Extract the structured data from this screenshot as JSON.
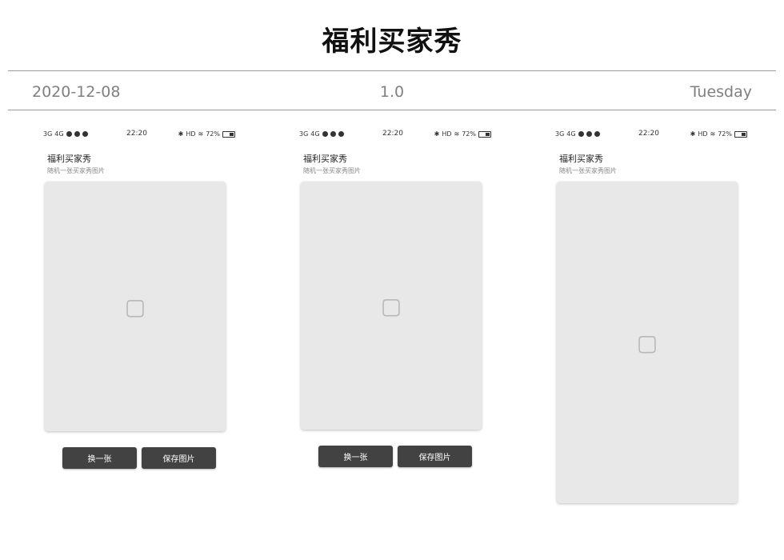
{
  "page": {
    "title": "福利买家秀"
  },
  "meta": {
    "date": "2020-12-08",
    "version": "1.0",
    "weekday": "Tuesday"
  },
  "screens": [
    {
      "status": {
        "signal_left": "3G",
        "signal_mid": "4G",
        "time": "22:20",
        "right_text": "HD",
        "battery": "72%"
      },
      "app_title": "福利买家秀",
      "app_subtitle": "随机一张买家秀图片",
      "image_alt": "image placeholder",
      "buttons": {
        "next": "换一张",
        "save": "保存图片"
      }
    },
    {
      "status": {
        "signal_left": "3G",
        "signal_mid": "4G",
        "time": "22:20",
        "right_text": "HD",
        "battery": "72%"
      },
      "app_title": "福利买家秀",
      "app_subtitle": "随机一张买家秀图片",
      "image_alt": "image placeholder",
      "buttons": {
        "next": "换一张",
        "save": "保存图片"
      }
    },
    {
      "status": {
        "signal_left": "3G",
        "signal_mid": "4G",
        "time": "22:20",
        "right_text": "HD",
        "battery": "72%"
      },
      "app_title": "福利买家秀",
      "app_subtitle": "随机一张买家秀图片",
      "image_alt": "image placeholder"
    }
  ],
  "colors": {
    "button_bg": "#424242",
    "rule": "#9a9a9a",
    "meta_text": "#808080"
  }
}
